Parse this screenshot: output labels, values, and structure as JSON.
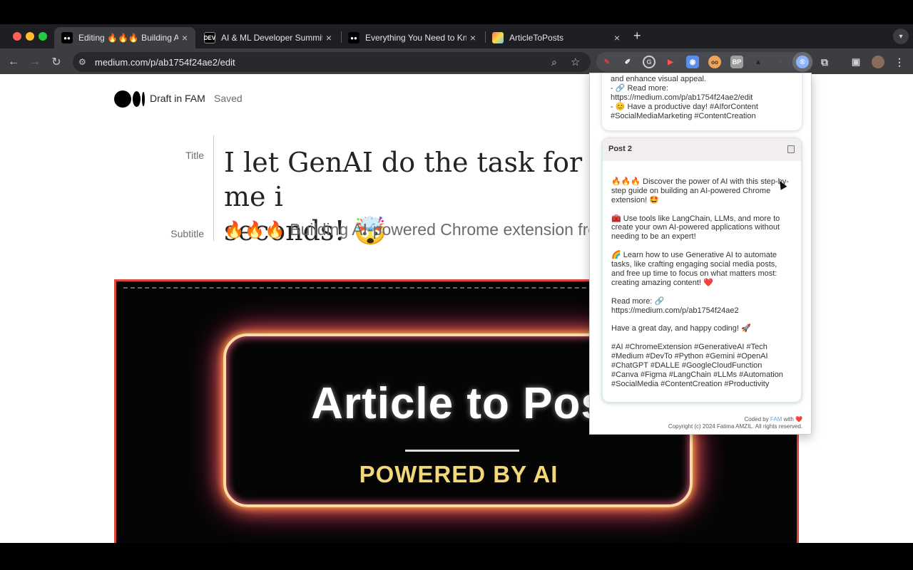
{
  "browser": {
    "tabs": [
      {
        "favicon": "medium-icon",
        "title": "Editing 🔥🔥🔥 Building AI-p",
        "active": true
      },
      {
        "favicon": "dev-icon",
        "favicon_text": "DEV",
        "title": "AI & ML Developer Summit in",
        "active": false
      },
      {
        "favicon": "medium-icon",
        "title": "Everything You Need to Know",
        "active": false
      },
      {
        "favicon": "articletoposts-icon",
        "title": "ArticleToPosts",
        "active": false
      }
    ],
    "new_tab": "+",
    "url": "medium.com/p/ab1754f24ae2/edit",
    "extensions": [
      {
        "icon": "red-pen-icon",
        "color": "#e53935"
      },
      {
        "icon": "eyedropper-icon",
        "color": "#ffffff"
      },
      {
        "icon": "grammarly-icon",
        "color": "#cfcfcf"
      },
      {
        "icon": "record-icon",
        "color": "#ff5252"
      },
      {
        "icon": "capture-icon",
        "color": "#5b8def"
      },
      {
        "icon": "owl-icon",
        "color": "#f0a35a"
      },
      {
        "icon": "bp-icon",
        "text": "BP",
        "color": "#9e9e9e"
      },
      {
        "icon": "triangle-icon",
        "color": "#444444"
      },
      {
        "icon": "lock-icon",
        "color": "#555555"
      },
      {
        "icon": "articletoposts-ext-icon",
        "color": "#8fb4ff"
      },
      {
        "icon": "puzzle-icon",
        "color": "#cfcfcf"
      }
    ]
  },
  "editor": {
    "draft_label": "Draft in FAM",
    "saved_label": "Saved",
    "title_label": "Title",
    "subtitle_label": "Subtitle",
    "title": "I let GenAI do the task for me i\nseconds! 🤯",
    "subtitle": "🔥🔥🔥 Building AI-powered Chrome extension fron",
    "hero": {
      "title": "Article to Pos",
      "subtitle": "POWERED BY AI"
    }
  },
  "popup": {
    "post1_tail": "and enhance visual appeal.\n- 🔗 Read more:\nhttps://medium.com/p/ab1754f24ae2/edit\n- 😊 Have a productive day! #AIforContent\n#SocialMediaMarketing #ContentCreation",
    "post2": {
      "label": "Post 2",
      "body": "\n🔥🔥🔥 Discover the power of AI with this step-by-\nstep guide on building an AI-powered Chrome\nextension! 🤩\n\n🧰 Use tools like LangChain, LLMs, and more to\ncreate your own AI-powered applications without\nneeding to be an expert!\n\n🌈 Learn how to use Generative AI to automate\ntasks, like crafting engaging social media posts,\nand free up time to focus on what matters most:\ncreating amazing content! ❤️\n\nRead more: 🔗\nhttps://medium.com/p/ab1754f24ae2\n\nHave a great day, and happy coding! 🚀\n\n#AI #ChromeExtension #GenerativeAI #Tech\n#Medium #DevTo #Python #Gemini #OpenAI\n#ChatGPT #DALLE #GoogleCloudFunction\n#Canva #Figma #LangChain #LLMs #Automation\n#SocialMedia #ContentCreation #Productivity"
    },
    "footer": {
      "coded_by": "Coded by ",
      "fam": "FAM",
      "with": " with ❤️",
      "copyright": "Copyright (c) 2024 Fatima AMZIL. All rights reserved."
    }
  }
}
